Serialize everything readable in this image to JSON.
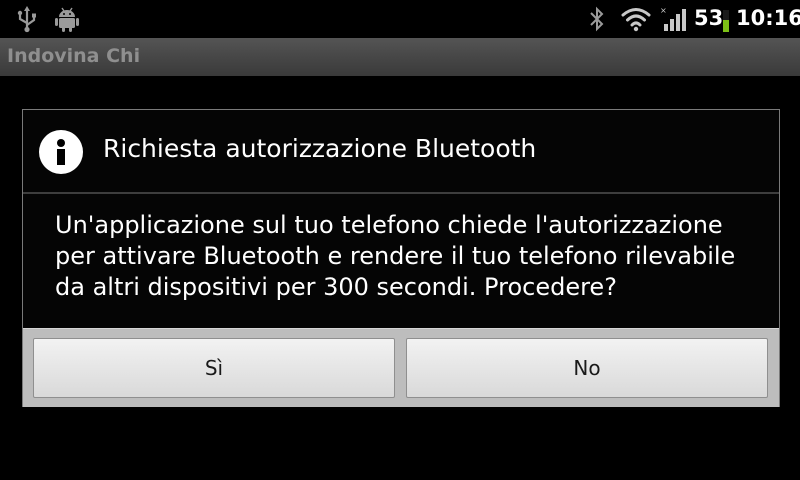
{
  "status_bar": {
    "icons": [
      "usb-icon",
      "android-debug-icon",
      "bluetooth-icon",
      "wifi-icon",
      "signal-icon"
    ],
    "battery_percent": "53",
    "battery_level": 0.53,
    "battery_color": "#7cc016",
    "time": "10:16"
  },
  "title_bar": {
    "title": "Indovina Chi"
  },
  "dialog": {
    "icon": "info-icon",
    "title": "Richiesta autorizzazione Bluetooth",
    "message": "Un'applicazione sul tuo telefono chiede l'autorizzazione per attivare Bluetooth e rendere il tuo telefono rilevabile da altri dispositivi per 300 secondi. Procedere?",
    "yes_label": "Sì",
    "no_label": "No"
  }
}
